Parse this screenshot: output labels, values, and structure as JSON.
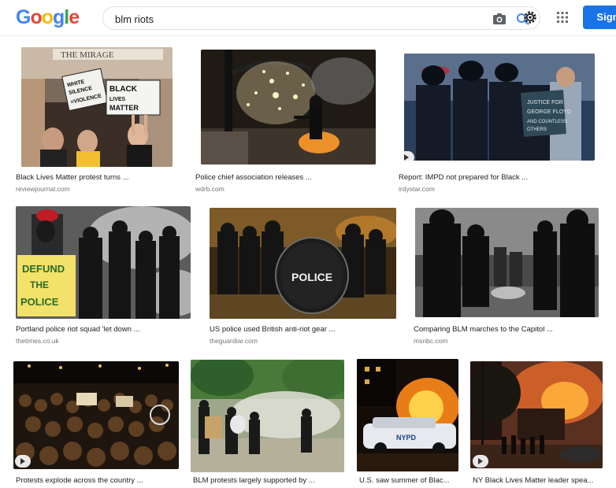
{
  "header": {
    "logo_letters": [
      {
        "ch": "G",
        "color": "#4285f4"
      },
      {
        "ch": "o",
        "color": "#ea4335"
      },
      {
        "ch": "o",
        "color": "#fbbc05"
      },
      {
        "ch": "g",
        "color": "#4285f4"
      },
      {
        "ch": "l",
        "color": "#34a853"
      },
      {
        "ch": "e",
        "color": "#ea4335"
      }
    ],
    "search_value": "blm riots",
    "camera_icon": "camera-icon",
    "lens_icon": "search-icon",
    "settings_icon": "gear-icon",
    "apps_icon": "apps-grid-icon",
    "signin_label": "Sign"
  },
  "results": [
    {
      "caption": "Black Lives Matter protest turns ...",
      "source": "reviewjournal.com",
      "video": false
    },
    {
      "caption": "Police chief association releases ...",
      "source": "wdrb.com",
      "video": false
    },
    {
      "caption": "Report: IMPD not prepared for Black ...",
      "source": "irdystar.com",
      "video": true
    },
    {
      "caption": "Portland police riot squad 'let down ...",
      "source": "thetimes.co.uk",
      "video": false
    },
    {
      "caption": "US police used British anti-riot gear ...",
      "source": "theguardiar.com",
      "video": false
    },
    {
      "caption": "Comparing BLM marches to the Capitol ...",
      "source": "msnbc.com",
      "video": false
    },
    {
      "caption": "Protests explode across the country ...",
      "source": "",
      "video": true
    },
    {
      "caption": "BLM protests largely supported by ...",
      "source": "",
      "video": false
    },
    {
      "caption": "U.S. saw summer of Blac...",
      "source": "",
      "video": false
    },
    {
      "caption": "NY Black Lives Matter leader spea...",
      "source": "",
      "video": true
    }
  ],
  "image_text": {
    "r1_sign1": "WHITE SILENCE = VIOLENCE",
    "r1_sign2": "BLACK LIVES MATTER",
    "r1_sign3": "THE MIRAGE",
    "r3_sign": "JUSTICE FOR GEORGE FLOYD AND COUNTLESS OTHERS",
    "r4_sign": "DEFUND THE POLICE",
    "r5_shield": "POLICE",
    "r9_car": "NYPD"
  }
}
